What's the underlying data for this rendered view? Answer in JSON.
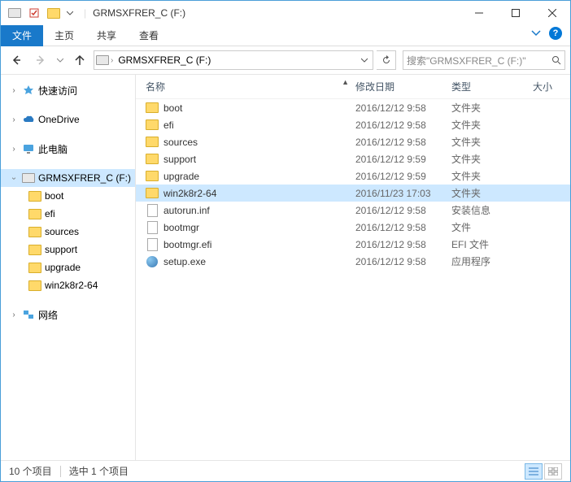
{
  "window": {
    "title": "GRMSXFRER_C (F:)"
  },
  "ribbon": {
    "tabs": [
      "文件",
      "主页",
      "共享",
      "查看"
    ],
    "active": 0
  },
  "nav": {
    "breadcrumb": "GRMSXFRER_C (F:)",
    "search_placeholder": "搜索\"GRMSXFRER_C (F:)\""
  },
  "sidebar": {
    "quick": {
      "label": "快速访问"
    },
    "onedrive": {
      "label": "OneDrive"
    },
    "thispc": {
      "label": "此电脑"
    },
    "drive": {
      "label": "GRMSXFRER_C (F:)",
      "children": [
        {
          "label": "boot"
        },
        {
          "label": "efi"
        },
        {
          "label": "sources"
        },
        {
          "label": "support"
        },
        {
          "label": "upgrade"
        },
        {
          "label": "win2k8r2-64"
        }
      ]
    },
    "network": {
      "label": "网络"
    }
  },
  "columns": {
    "name": "名称",
    "date": "修改日期",
    "type": "类型",
    "size": "大小"
  },
  "files": [
    {
      "icon": "folder",
      "name": "boot",
      "date": "2016/12/12 9:58",
      "type": "文件夹",
      "size": "",
      "selected": false
    },
    {
      "icon": "folder",
      "name": "efi",
      "date": "2016/12/12 9:58",
      "type": "文件夹",
      "size": "",
      "selected": false
    },
    {
      "icon": "folder",
      "name": "sources",
      "date": "2016/12/12 9:58",
      "type": "文件夹",
      "size": "",
      "selected": false
    },
    {
      "icon": "folder",
      "name": "support",
      "date": "2016/12/12 9:59",
      "type": "文件夹",
      "size": "",
      "selected": false
    },
    {
      "icon": "folder",
      "name": "upgrade",
      "date": "2016/12/12 9:59",
      "type": "文件夹",
      "size": "",
      "selected": false
    },
    {
      "icon": "folder",
      "name": "win2k8r2-64",
      "date": "2016/11/23 17:03",
      "type": "文件夹",
      "size": "",
      "selected": true
    },
    {
      "icon": "file",
      "name": "autorun.inf",
      "date": "2016/12/12 9:58",
      "type": "安装信息",
      "size": "",
      "selected": false
    },
    {
      "icon": "file",
      "name": "bootmgr",
      "date": "2016/12/12 9:58",
      "type": "文件",
      "size": "",
      "selected": false
    },
    {
      "icon": "file",
      "name": "bootmgr.efi",
      "date": "2016/12/12 9:58",
      "type": "EFI 文件",
      "size": "",
      "selected": false
    },
    {
      "icon": "exe",
      "name": "setup.exe",
      "date": "2016/12/12 9:58",
      "type": "应用程序",
      "size": "",
      "selected": false
    }
  ],
  "status": {
    "count": "10 个项目",
    "selected": "选中 1 个项目"
  }
}
